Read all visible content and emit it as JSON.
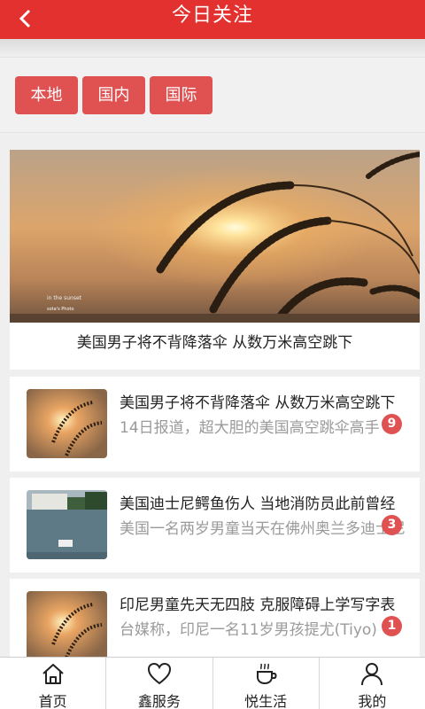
{
  "header": {
    "title": "今日关注"
  },
  "filters": [
    {
      "label": "本地"
    },
    {
      "label": "国内"
    },
    {
      "label": "国际"
    }
  ],
  "hero": {
    "caption": "美国男子将不背降落伞 从数万米高空跳下",
    "watermark_small": "in the sunset",
    "watermark_sig": "sota's Photo"
  },
  "news": [
    {
      "title": "美国男子将不背降落伞 从数万米高空跳下",
      "summary": "14日报道，超大胆的美国高空跳伞高手",
      "badge": "9",
      "thumb": "sunset"
    },
    {
      "title": "美国迪士尼鳄鱼伤人 当地消防员此前曾经",
      "summary": "美国一名两岁男童当天在佛州奥兰多迪士尼",
      "badge": "3",
      "thumb": "lake"
    },
    {
      "title": "印尼男童先天无四肢 克服障碍上学写字表",
      "summary": "台媒称，印尼一名11岁男孩提尤(Tiyo)",
      "badge": "1",
      "thumb": "sunset"
    }
  ],
  "tabbar": [
    {
      "label": "首页",
      "icon": "home-icon"
    },
    {
      "label": "鑫服务",
      "icon": "heart-icon"
    },
    {
      "label": "悦生活",
      "icon": "coffee-icon"
    },
    {
      "label": "我的",
      "icon": "user-icon"
    }
  ],
  "colors": {
    "brand": "#e2312f",
    "chip": "#e05152"
  }
}
